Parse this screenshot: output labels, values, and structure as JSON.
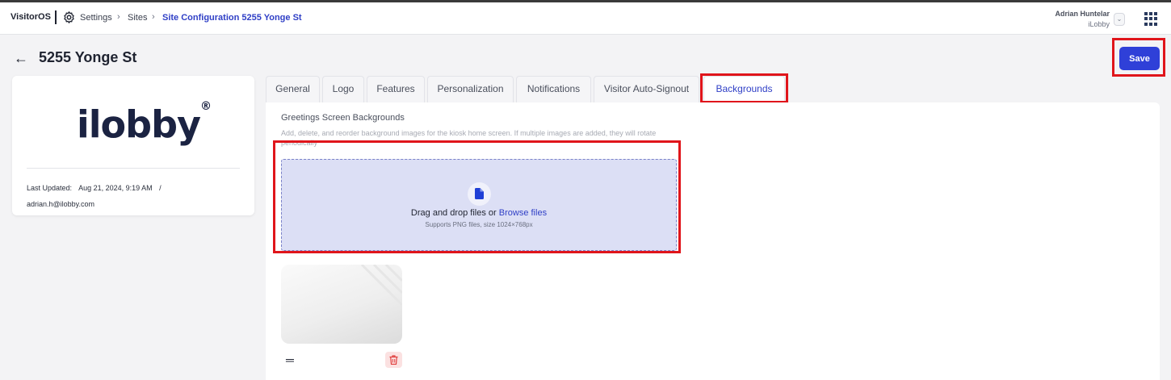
{
  "header": {
    "brand": "VisitorOS",
    "breadcrumbs": [
      "Settings",
      "Sites",
      "Site Configuration 5255 Yonge St"
    ],
    "user_name": "Adrian Huntelar",
    "user_org": "iLobby",
    "icons": {
      "settings": "gear-icon",
      "user_menu": "chevron-down-icon",
      "apps": "grid-icon"
    }
  },
  "page": {
    "title": "5255 Yonge St",
    "save_label": "Save"
  },
  "site_card": {
    "logo_text": "ilobby",
    "logo_mark": "®",
    "last_updated_label": "Last Updated:",
    "last_updated_value": "Aug 21, 2024, 9:19 AM",
    "separator": "/",
    "updated_by": "adrian.h@ilobby.com"
  },
  "tabs": [
    {
      "label": "General"
    },
    {
      "label": "Logo"
    },
    {
      "label": "Features"
    },
    {
      "label": "Personalization"
    },
    {
      "label": "Notifications"
    },
    {
      "label": "Visitor Auto-Signout"
    },
    {
      "label": "Backgrounds",
      "active": true
    }
  ],
  "backgrounds": {
    "section_title": "Greetings Screen Backgrounds",
    "section_desc": "Add, delete, and reorder background images for the kiosk home screen. If multiple images are added, they will rotate periodically",
    "drop_text": "Drag and drop files or",
    "browse_link": "Browse files",
    "drop_sub": "Supports PNG files, size 1024×768px"
  },
  "colors": {
    "accent": "#2f40d8",
    "highlight": "#e0151b",
    "dropzone_bg": "#dcdff5",
    "delete_bg": "#fbe1e1"
  }
}
